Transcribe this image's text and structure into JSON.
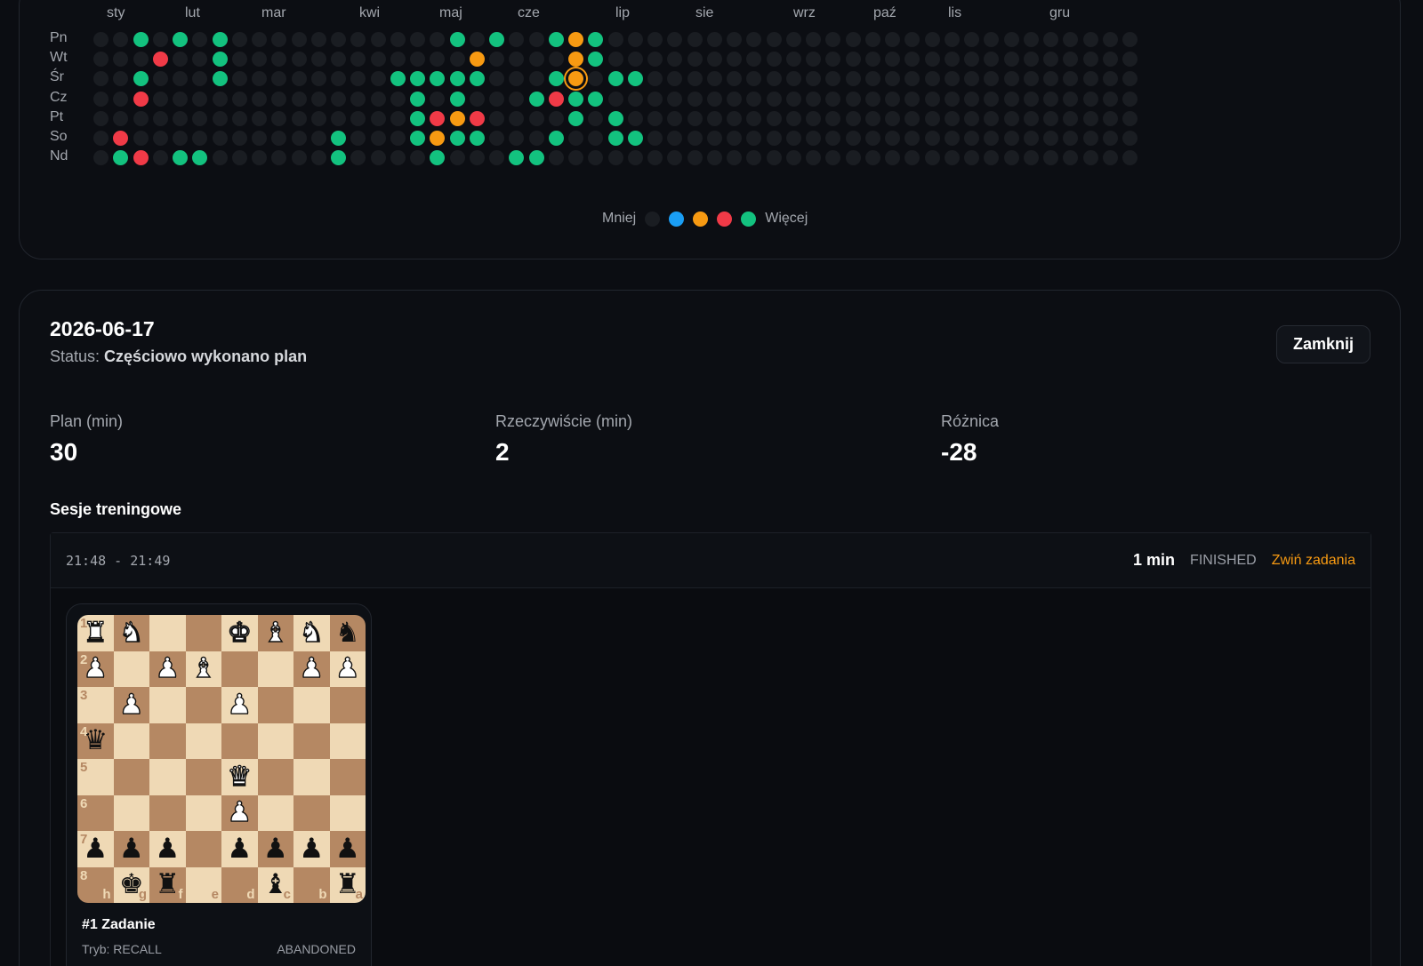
{
  "heatmap": {
    "months": [
      "sty",
      "lut",
      "mar",
      "kwi",
      "maj",
      "cze",
      "lip",
      "sie",
      "wrz",
      "paź",
      "lis",
      "gru"
    ],
    "days": [
      "Pn",
      "Wt",
      "Śr",
      "Cz",
      "Pt",
      "So",
      "Nd"
    ],
    "weeks": 53,
    "active": [
      {
        "w": 2,
        "d": 0,
        "c": "green"
      },
      {
        "w": 4,
        "d": 0,
        "c": "green"
      },
      {
        "w": 6,
        "d": 0,
        "c": "green"
      },
      {
        "w": 18,
        "d": 0,
        "c": "green"
      },
      {
        "w": 20,
        "d": 0,
        "c": "green"
      },
      {
        "w": 23,
        "d": 0,
        "c": "green"
      },
      {
        "w": 24,
        "d": 0,
        "c": "orange"
      },
      {
        "w": 25,
        "d": 0,
        "c": "green"
      },
      {
        "w": 3,
        "d": 1,
        "c": "red"
      },
      {
        "w": 6,
        "d": 1,
        "c": "green"
      },
      {
        "w": 19,
        "d": 1,
        "c": "orange"
      },
      {
        "w": 24,
        "d": 1,
        "c": "orange"
      },
      {
        "w": 25,
        "d": 1,
        "c": "green"
      },
      {
        "w": 2,
        "d": 2,
        "c": "green"
      },
      {
        "w": 6,
        "d": 2,
        "c": "green"
      },
      {
        "w": 15,
        "d": 2,
        "c": "green"
      },
      {
        "w": 16,
        "d": 2,
        "c": "green"
      },
      {
        "w": 17,
        "d": 2,
        "c": "green"
      },
      {
        "w": 18,
        "d": 2,
        "c": "green"
      },
      {
        "w": 19,
        "d": 2,
        "c": "green"
      },
      {
        "w": 23,
        "d": 2,
        "c": "green"
      },
      {
        "w": 24,
        "d": 2,
        "c": "orange",
        "selected": true
      },
      {
        "w": 26,
        "d": 2,
        "c": "green"
      },
      {
        "w": 27,
        "d": 2,
        "c": "green"
      },
      {
        "w": 2,
        "d": 3,
        "c": "red"
      },
      {
        "w": 16,
        "d": 3,
        "c": "green"
      },
      {
        "w": 18,
        "d": 3,
        "c": "green"
      },
      {
        "w": 22,
        "d": 3,
        "c": "green"
      },
      {
        "w": 23,
        "d": 3,
        "c": "red"
      },
      {
        "w": 24,
        "d": 3,
        "c": "green"
      },
      {
        "w": 25,
        "d": 3,
        "c": "green"
      },
      {
        "w": 16,
        "d": 4,
        "c": "green"
      },
      {
        "w": 17,
        "d": 4,
        "c": "red"
      },
      {
        "w": 18,
        "d": 4,
        "c": "orange"
      },
      {
        "w": 19,
        "d": 4,
        "c": "red"
      },
      {
        "w": 24,
        "d": 4,
        "c": "green"
      },
      {
        "w": 26,
        "d": 4,
        "c": "green"
      },
      {
        "w": 1,
        "d": 5,
        "c": "red"
      },
      {
        "w": 12,
        "d": 5,
        "c": "green"
      },
      {
        "w": 16,
        "d": 5,
        "c": "green"
      },
      {
        "w": 17,
        "d": 5,
        "c": "orange"
      },
      {
        "w": 18,
        "d": 5,
        "c": "green"
      },
      {
        "w": 19,
        "d": 5,
        "c": "green"
      },
      {
        "w": 23,
        "d": 5,
        "c": "green"
      },
      {
        "w": 26,
        "d": 5,
        "c": "green"
      },
      {
        "w": 27,
        "d": 5,
        "c": "green"
      },
      {
        "w": 1,
        "d": 6,
        "c": "green"
      },
      {
        "w": 2,
        "d": 6,
        "c": "red"
      },
      {
        "w": 4,
        "d": 6,
        "c": "green"
      },
      {
        "w": 5,
        "d": 6,
        "c": "green"
      },
      {
        "w": 12,
        "d": 6,
        "c": "green"
      },
      {
        "w": 17,
        "d": 6,
        "c": "green"
      },
      {
        "w": 21,
        "d": 6,
        "c": "green"
      },
      {
        "w": 22,
        "d": 6,
        "c": "green"
      }
    ],
    "colors": {
      "empty": "#1a1d22",
      "blue": "#1a9ef5",
      "orange": "#f79a12",
      "red": "#f03a47",
      "green": "#13c27f"
    },
    "legend": {
      "less": "Mniej",
      "more": "Więcej",
      "items": [
        "empty",
        "blue",
        "orange",
        "red",
        "green"
      ]
    }
  },
  "detail": {
    "date": "2026-06-17",
    "status_label": "Status:",
    "status_value": "Częściowo wykonano plan",
    "close_label": "Zamknij",
    "stats": [
      {
        "label": "Plan (min)",
        "value": "30"
      },
      {
        "label": "Rzeczywiście (min)",
        "value": "2"
      },
      {
        "label": "Różnica",
        "value": "-28"
      }
    ],
    "sessions_title": "Sesje treningowe",
    "session": {
      "time": "21:48 - 21:49",
      "duration": "1 min",
      "state": "FINISHED",
      "toggle_label": "Zwiń zadania"
    },
    "task": {
      "title": "#1 Zadanie",
      "mode": "Tryb: RECALL",
      "result": "ABANDONED",
      "rank_labels": [
        "1",
        "2",
        "3",
        "4",
        "5",
        "6",
        "7",
        "8"
      ],
      "file_labels": [
        "h",
        "g",
        "f",
        "e",
        "d",
        "c",
        "b",
        "a"
      ],
      "board": [
        [
          "wR",
          "wN",
          "",
          "",
          "wK",
          "wB",
          "wN",
          "bN"
        ],
        [
          "wP",
          "",
          "wP",
          "wB",
          "",
          "",
          "wP",
          "wP"
        ],
        [
          "",
          "wP",
          "",
          "",
          "wP",
          "",
          "",
          ""
        ],
        [
          "bQ",
          "",
          "",
          "",
          "",
          "",
          "",
          ""
        ],
        [
          "",
          "",
          "",
          "",
          "wQ",
          "",
          "",
          ""
        ],
        [
          "",
          "",
          "",
          "",
          "wP",
          "",
          "",
          ""
        ],
        [
          "bP",
          "bP",
          "bP",
          "",
          "bP",
          "bP",
          "bP",
          "bP"
        ],
        [
          "",
          "bK",
          "bR",
          "",
          "",
          "bB",
          "",
          "bR"
        ]
      ]
    }
  }
}
